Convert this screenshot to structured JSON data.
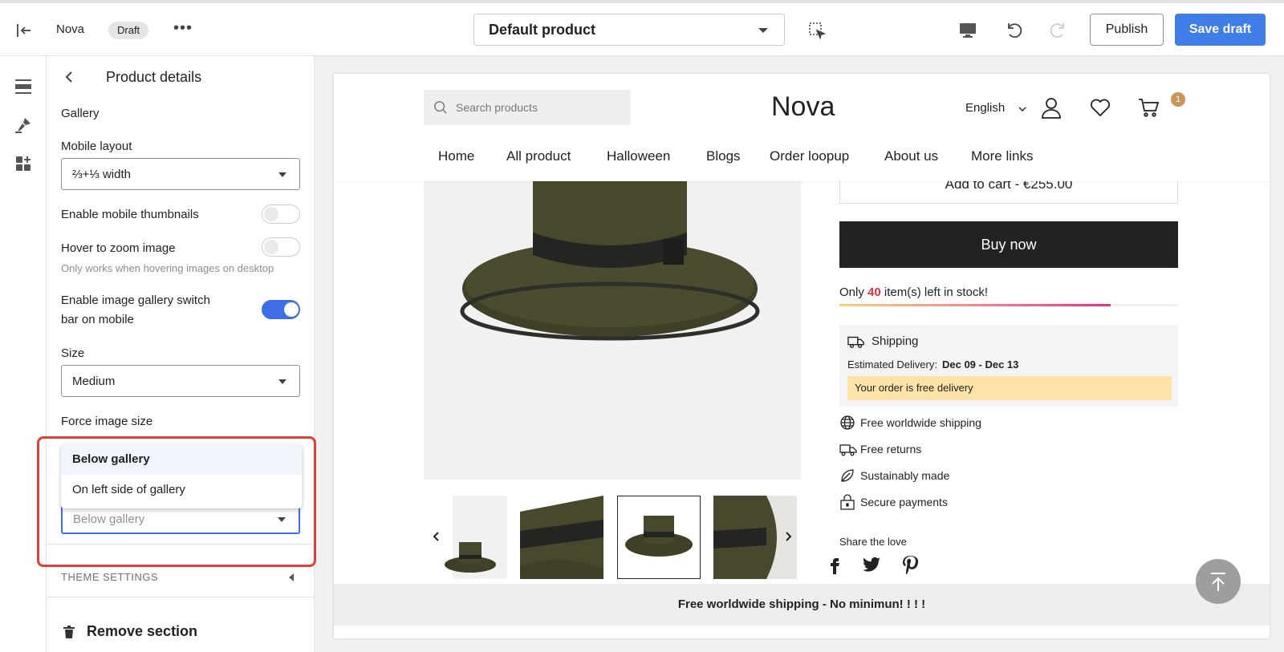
{
  "topbar": {
    "store_name": "Nova",
    "status_badge": "Draft",
    "more": "•••",
    "template_select": "Default product",
    "publish_label": "Publish",
    "save_label": "Save draft"
  },
  "panel": {
    "title": "Product details",
    "section_heading": "Gallery",
    "mobile_layout_label": "Mobile layout",
    "mobile_layout_value": "⅔+⅓ width",
    "mobile_thumbnails_label": "Enable mobile thumbnails",
    "hover_zoom_label": "Hover to zoom image",
    "hover_zoom_help": "Only works when hovering images on desktop",
    "switch_bar_label_line1": "Enable image gallery switch",
    "switch_bar_label_line2": "bar on mobile",
    "size_label": "Size",
    "size_value": "Medium",
    "force_size_label": "Force image size",
    "thumb_position_options": [
      "Below gallery",
      "On left side of gallery"
    ],
    "thumb_position_value": "Below gallery",
    "theme_settings": "THEME SETTINGS",
    "remove_section": "Remove section"
  },
  "store": {
    "search_placeholder": "Search products",
    "logo": "Nova",
    "language": "English",
    "cart_count": "1",
    "nav": [
      "Home",
      "All product",
      "Halloween",
      "Blogs",
      "Order loopup",
      "About us",
      "More links"
    ],
    "add_to_cart": "Add to cart  -  €255.00",
    "buy_now": "Buy now",
    "stock_prefix": "Only ",
    "stock_count": "40",
    "stock_suffix": " item(s) left in stock!",
    "stock_fraction": 0.8,
    "shipping_title": "Shipping",
    "estimated_label": "Estimated Delivery:",
    "estimated_dates": "Dec 09 - Dec 13",
    "free_delivery": "Your order is free delivery",
    "features": [
      "Free worldwide shipping",
      "Free returns",
      "Sustainably made",
      "Secure payments"
    ],
    "share_label": "Share the love",
    "footer_banner": "Free worldwide shipping - No minimun!  !  !  !"
  },
  "colors": {
    "accent": "#3f7ee8",
    "highlight": "#e0403b",
    "hat": "#48492c",
    "band": "#242422"
  }
}
